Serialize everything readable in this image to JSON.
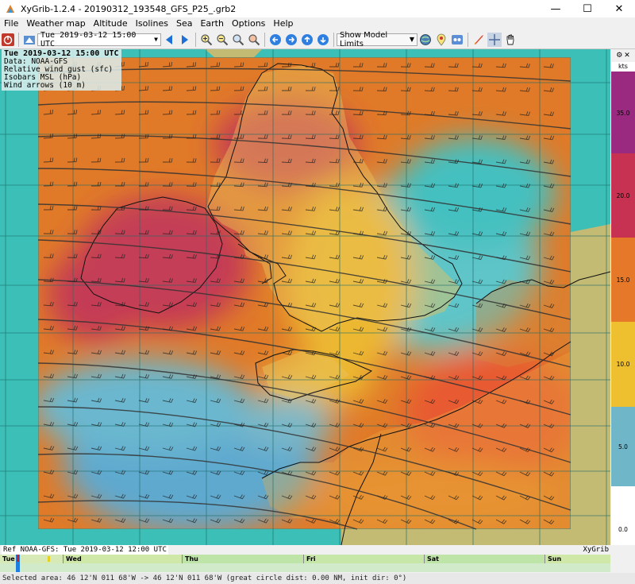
{
  "window": {
    "title": "XyGrib-1.2.4 - 20190312_193548_GFS_P25_.grb2",
    "minimize": "—",
    "maximize": "☐",
    "close": "✕"
  },
  "menu": [
    "File",
    "Weather map",
    "Altitude",
    "Isolines",
    "Sea",
    "Earth",
    "Options",
    "Help"
  ],
  "toolbar": {
    "datetime": "Tue 2019-03-12 15:00 UTC",
    "model_limits": "Show Model Limits"
  },
  "info": {
    "date": "Tue 2019-03-12 15:00 UTC",
    "data": "Data: NOAA-GFS",
    "layer": "Relative wind gust (sfc)",
    "isobars": "Isobars MSL (hPa)",
    "arrows": "Wind arrows (10 m)"
  },
  "legend": {
    "header_icon": "settings-icon",
    "units": "kts",
    "labels": [
      "35.0",
      "20.0",
      "15.0",
      "10.0",
      "5.0",
      "0.0"
    ],
    "colors": [
      "#9a2a80",
      "#c83252",
      "#e6782a",
      "#eec030",
      "#6fb6c8",
      "#ffffff"
    ]
  },
  "footer": {
    "ref": "Ref NOAA-GFS: Tue 2019-03-12 12:00 UTC",
    "brand": "XyGrib"
  },
  "timeline": {
    "days": [
      "Tue",
      "Wed",
      "Thu",
      "Fri",
      "Sat",
      "Sun"
    ]
  },
  "status": "Selected area: 46 12'N 011 68'W -> 46 12'N 011 68'W   (great circle dist: 0.00 NM, init dir: 0°)",
  "colors": {
    "sea": "#3cbfb7",
    "land": "#c3ba74",
    "orange": "#e07a28",
    "red": "#c43a55",
    "yellow": "#ecb832",
    "blue": "#5fa9cf"
  }
}
